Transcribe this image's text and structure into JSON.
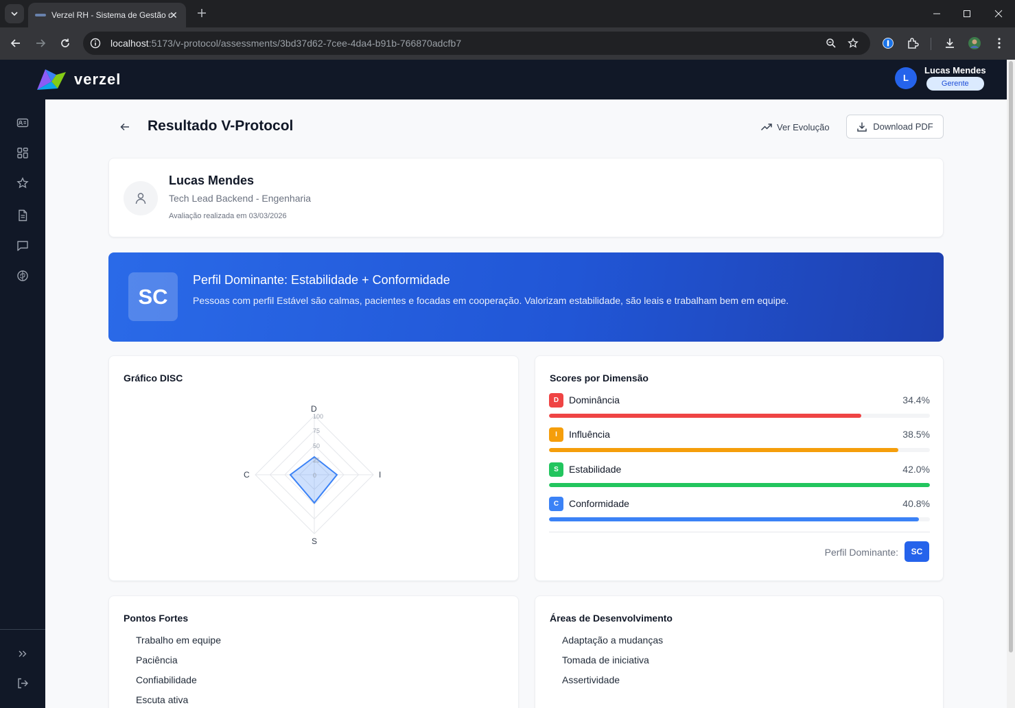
{
  "browser": {
    "tab_title": "Verzel RH - Sistema de Gestão de",
    "url_host": "localhost",
    "url_path": ":5173/v-protocol/assessments/3bd37d62-7cee-4da4-b91b-766870adcfb7"
  },
  "header": {
    "brand": "verzel",
    "user_initial": "L",
    "user_name": "Lucas Mendes",
    "user_role": "Gerente"
  },
  "page": {
    "title": "Resultado V-Protocol",
    "evolution_label": "Ver Evolução",
    "download_label": "Download PDF"
  },
  "profile": {
    "name": "Lucas Mendes",
    "job": "Tech Lead Backend - Engenharia",
    "date": "Avaliação realizada em 03/03/2026"
  },
  "banner": {
    "badge": "SC",
    "title": "Perfil Dominante: Estabilidade + Conformidade",
    "description": "Pessoas com perfil Estável são calmas, pacientes e focadas em cooperação. Valorizam estabilidade, são leais e trabalham bem em equipe."
  },
  "disc_chart": {
    "title": "Gráfico DISC",
    "axes": [
      "D",
      "I",
      "S",
      "C"
    ],
    "ticks": [
      "100",
      "75",
      "50",
      "25",
      "0"
    ]
  },
  "scores": {
    "title": "Scores por Dimensão",
    "items": [
      {
        "letter": "D",
        "name": "Dominância",
        "value": "34.4%",
        "fraction": 0.82,
        "color": "#ef4444"
      },
      {
        "letter": "I",
        "name": "Influência",
        "value": "38.5%",
        "fraction": 0.917,
        "color": "#f59e0b"
      },
      {
        "letter": "S",
        "name": "Estabilidade",
        "value": "42.0%",
        "fraction": 1.0,
        "color": "#22c55e"
      },
      {
        "letter": "C",
        "name": "Conformidade",
        "value": "40.8%",
        "fraction": 0.971,
        "color": "#3b82f6"
      }
    ],
    "dominant_label": "Perfil Dominante:",
    "dominant_badge": "SC"
  },
  "strengths": {
    "title": "Pontos Fortes",
    "items": [
      "Trabalho em equipe",
      "Paciência",
      "Confiabilidade",
      "Escuta ativa"
    ]
  },
  "development": {
    "title": "Áreas de Desenvolvimento",
    "items": [
      "Adaptação a mudanças",
      "Tomada de iniciativa",
      "Assertividade"
    ]
  }
}
